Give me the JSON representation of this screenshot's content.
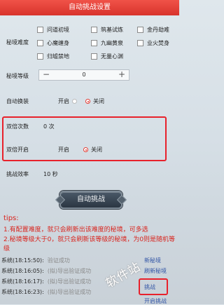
{
  "title": "自动挑战设置",
  "difficulty": {
    "label": "秘境难度",
    "options": [
      [
        "问道初境",
        "筑基试炼",
        "金丹劫难"
      ],
      [
        "心魔缠身",
        "九幽黄泉",
        "业火焚身"
      ],
      [
        "归墟禁地",
        "无量心渊"
      ]
    ]
  },
  "level": {
    "label": "秘境等级",
    "value": "0",
    "minus": "−",
    "plus": "+"
  },
  "auto_equip": {
    "label": "自动换装",
    "on": "开启",
    "off": "关闭"
  },
  "double_count": {
    "label": "双倍次数",
    "value": "0 次"
  },
  "double_enable": {
    "label": "双倍开启",
    "on": "开启",
    "off": "关闭"
  },
  "efficiency": {
    "label": "挑战效率",
    "value": "10 秒"
  },
  "start_button": "自动挑战",
  "tips": {
    "title": "tips:",
    "line1": "1.有配置难度，就只会刷新出该难度的秘境，可多选",
    "line2": "2.秘境等级大于0，就只会刷新该等级的秘境，为0则是随机等级"
  },
  "logs": [
    {
      "time": "系统(18:15:50):",
      "msg": "验证成功"
    },
    {
      "time": "系统(18:16:05):",
      "msg": "(拟)导出验证成功"
    },
    {
      "time": "系统(18:16:17):",
      "msg": "(拟)导出验证成功"
    },
    {
      "time": "系统(18:16:23):",
      "msg": "(拟)导出验证成功"
    }
  ],
  "overlay": [
    "新秘境",
    "刷新秘境",
    "挑战",
    "开启挑战"
  ],
  "watermark": "软件站"
}
